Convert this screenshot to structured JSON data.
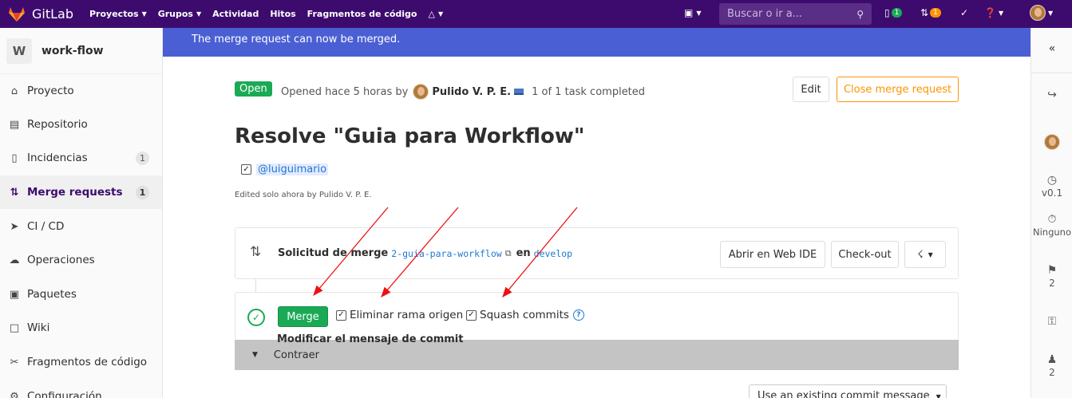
{
  "topbar": {
    "logo_text": "GitLab",
    "nav": [
      "Proyectos",
      "Grupos",
      "Actividad",
      "Hitos",
      "Fragmentos de código"
    ],
    "search_placeholder": "Buscar o ir a...",
    "issues_count": "1",
    "mr_count": "1"
  },
  "sidebar": {
    "project_initial": "W",
    "project_name": "work-flow",
    "items": [
      {
        "label": "Proyecto",
        "icon": "home-icon"
      },
      {
        "label": "Repositorio",
        "icon": "book-icon"
      },
      {
        "label": "Incidencias",
        "icon": "issues-icon",
        "count": "1"
      },
      {
        "label": "Merge requests",
        "icon": "merge-request-icon",
        "count": "1",
        "active": true
      },
      {
        "label": "CI / CD",
        "icon": "rocket-icon"
      },
      {
        "label": "Operaciones",
        "icon": "cloud-icon"
      },
      {
        "label": "Paquetes",
        "icon": "package-icon"
      },
      {
        "label": "Wiki",
        "icon": "wiki-icon"
      },
      {
        "label": "Fragmentos de código",
        "icon": "snippet-icon"
      },
      {
        "label": "Configuración",
        "icon": "settings-icon"
      }
    ]
  },
  "flash": {
    "message": "The merge request can now be merged."
  },
  "mr": {
    "status": "Open",
    "opened_text": "Opened hace 5 horas by",
    "author": "Pulido V. P. E.",
    "tasks": "1 of 1 task completed",
    "edit_label": "Edit",
    "close_label": "Close merge request",
    "title": "Resolve \"Guia para Workflow\"",
    "mention": "@luiguimario",
    "edited": "Edited solo ahora by Pulido V. P. E."
  },
  "widget": {
    "label": "Solicitud de merge",
    "source_branch": "2-guia-para-workflow",
    "connector": "en",
    "target_branch": "develop",
    "web_ide_label": "Abrir en Web IDE",
    "checkout_label": "Check-out"
  },
  "merge_box": {
    "merge_label": "Merge",
    "remove_branch_label": "Eliminar rama origen",
    "squash_label": "Squash commits",
    "collapse_label": "Contraer",
    "commit_msg_label": "Modificar el mensaje de commit",
    "commit_select_value": "Use an existing commit message"
  },
  "rightbar": {
    "milestone": "v0.1",
    "time_tracking": "Ninguno",
    "labels_count": "2",
    "participants_count": "2"
  },
  "colors": {
    "nav_bg": "#3d0b6e",
    "flash_bg": "#4b5fd4",
    "success": "#1aaa55",
    "warning": "#fc9403",
    "annotation_arrow": "#ee1111"
  }
}
